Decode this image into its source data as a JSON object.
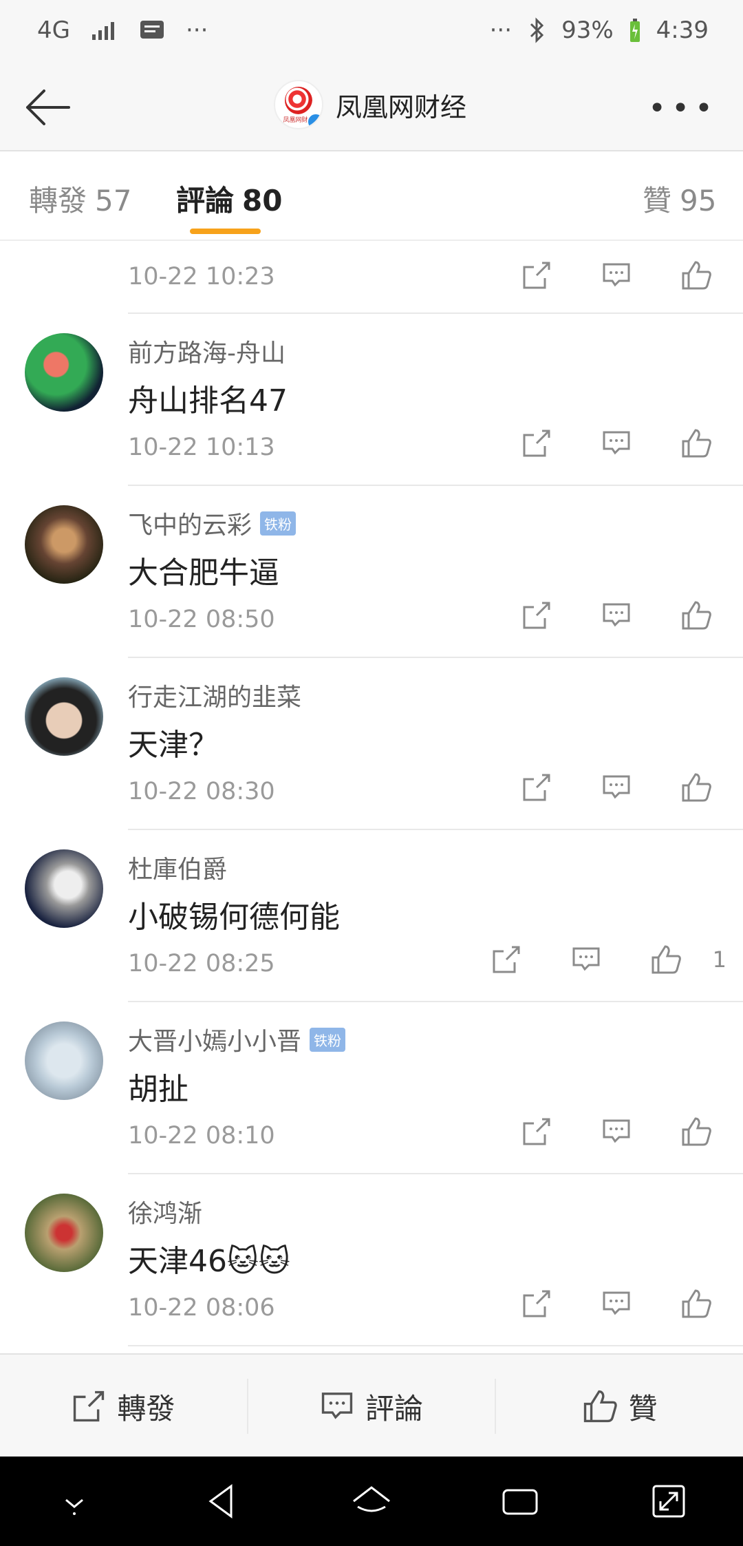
{
  "status": {
    "network": "4G",
    "battery": "93%",
    "time": "4:39",
    "more": "···"
  },
  "header": {
    "title": "凤凰网财经",
    "logo_text": "凤凰网财经"
  },
  "tabs": [
    {
      "label": "轉發",
      "count": "57"
    },
    {
      "label": "評論",
      "count": "80"
    },
    {
      "label": "贊",
      "count": "95"
    }
  ],
  "comments": [
    {
      "time": "10-22 10:23"
    },
    {
      "name": "前方路海-舟山",
      "badge": "",
      "text": "舟山排名47",
      "time": "10-22 10:13",
      "likes": ""
    },
    {
      "name": "飞中的云彩",
      "badge": "铁粉",
      "text": "大合肥牛逼",
      "time": "10-22 08:50",
      "likes": ""
    },
    {
      "name": "行走江湖的韭菜",
      "badge": "",
      "text": "天津？",
      "time": "10-22 08:30",
      "likes": ""
    },
    {
      "name": "杜庫伯爵",
      "badge": "",
      "text": "小破锡何德何能",
      "time": "10-22 08:25",
      "likes": "1"
    },
    {
      "name": "大晋小嫣小小晋",
      "badge": "铁粉",
      "text": "胡扯",
      "time": "10-22 08:10",
      "likes": ""
    },
    {
      "name": "徐鸿渐",
      "badge": "",
      "text": "天津46🐱🐱",
      "time": "10-22 08:06",
      "likes": ""
    }
  ],
  "bottom": {
    "repost": "轉發",
    "comment": "評論",
    "like": "贊"
  },
  "colors": {
    "accent": "#f7a21b",
    "badge": "#8fb6e8",
    "verified": "#2a8fe5"
  }
}
